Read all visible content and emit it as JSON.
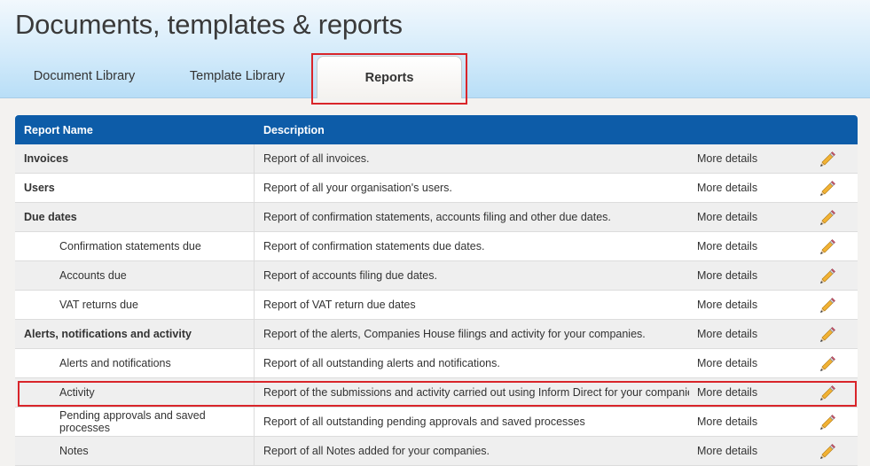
{
  "page": {
    "title": "Documents, templates & reports"
  },
  "tabs": [
    {
      "label": "Document Library",
      "active": false
    },
    {
      "label": "Template Library",
      "active": false
    },
    {
      "label": "Reports",
      "active": true
    }
  ],
  "table": {
    "headers": {
      "name": "Report Name",
      "description": "Description"
    },
    "more_label": "More details",
    "rows": [
      {
        "name": "Invoices",
        "description": "Report of all invoices.",
        "more": "More details",
        "level": "parent"
      },
      {
        "name": "Users",
        "description": "Report of all your organisation's users.",
        "more": "More details",
        "level": "parent"
      },
      {
        "name": "Due dates",
        "description": "Report of confirmation statements, accounts filing and other due dates.",
        "more": "More details",
        "level": "parent"
      },
      {
        "name": "Confirmation statements due",
        "description": "Report of confirmation statements due dates.",
        "more": "More details",
        "level": "child"
      },
      {
        "name": "Accounts due",
        "description": "Report of accounts filing due dates.",
        "more": "More details",
        "level": "child"
      },
      {
        "name": "VAT returns due",
        "description": "Report of VAT return due dates",
        "more": "More details",
        "level": "child"
      },
      {
        "name": "Alerts, notifications and activity",
        "description": "Report of the alerts, Companies House filings and activity for your companies.",
        "more": "More details",
        "level": "parent"
      },
      {
        "name": "Alerts and notifications",
        "description": "Report of all outstanding alerts and notifications.",
        "more": "More details",
        "level": "child"
      },
      {
        "name": "Activity",
        "description": "Report of the submissions and activity carried out using Inform Direct for your companies.",
        "more": "More details",
        "level": "child"
      },
      {
        "name": "Pending approvals and saved processes",
        "description": "Report of all outstanding pending approvals and saved processes",
        "more": "More details",
        "level": "child"
      },
      {
        "name": "Notes",
        "description": "Report of all Notes added for your companies.",
        "more": "More details",
        "level": "child"
      }
    ]
  },
  "colors": {
    "header_bar": "#0d5ca8",
    "highlight": "#d9252a",
    "pencil": "#f2b233"
  },
  "icons": {
    "edit": "pencil-icon"
  }
}
